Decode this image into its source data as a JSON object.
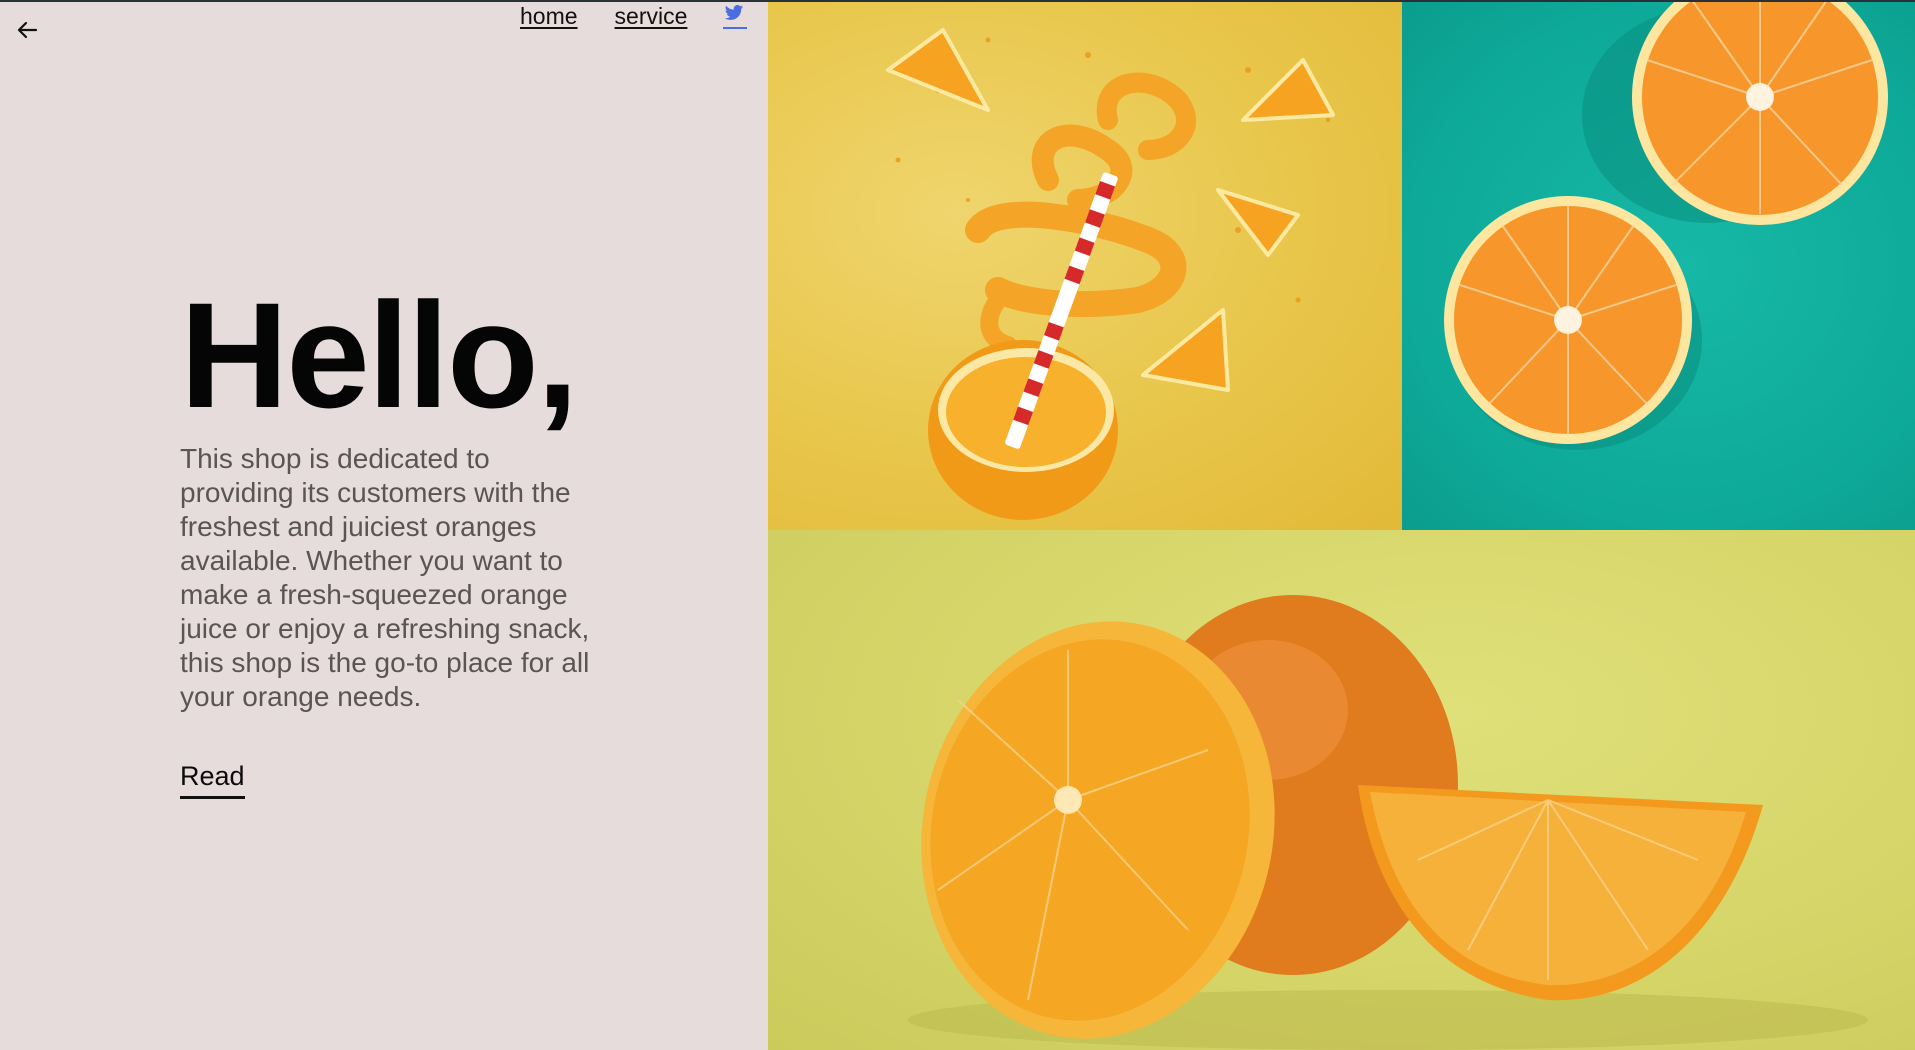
{
  "nav": {
    "back_icon": "arrow-left-icon",
    "items": [
      {
        "label": "home"
      },
      {
        "label": "service"
      }
    ],
    "twitter_icon": "twitter-icon",
    "twitter_color": "#4a6de0"
  },
  "hero": {
    "title": "Hello,",
    "description": "This shop is dedicated to providing its customers with the freshest and juiciest oranges available. Whether you want to make a fresh-squeezed orange juice or enjoy a refreshing snack, this shop is the go-to place for all your orange needs.",
    "cta_label": "Read"
  },
  "gallery": {
    "colors": {
      "panel_background": "#e6dcdc",
      "yellow_background": "#e8c64a",
      "teal_background": "#0ea998",
      "green_background": "#d6d66a",
      "orange": "#f29a1e"
    }
  }
}
